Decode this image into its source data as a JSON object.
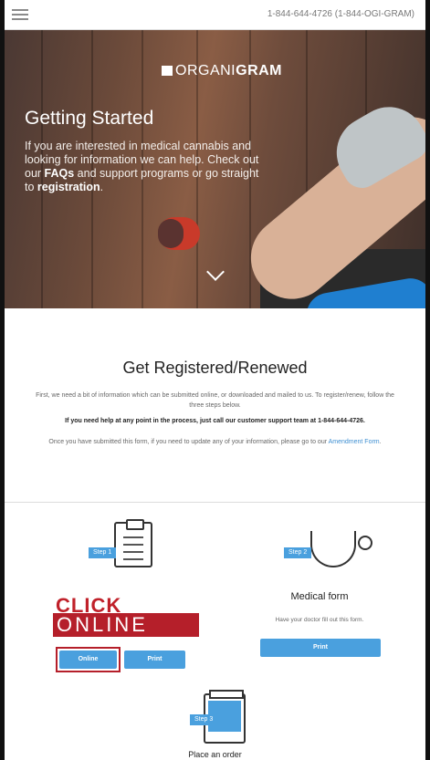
{
  "header": {
    "menu_icon": "hamburger-icon",
    "phone": "1-844-644-4726 (1-844-OGI-GRAM)"
  },
  "hero": {
    "logo_light": "ORGANI",
    "logo_bold": "GRAM",
    "title": "Getting Started",
    "text_1": "If you are interested in medical cannabis and looking for information we can help. Check out our ",
    "faqs_link": "FAQs",
    "text_2": " and support programs or go straight to ",
    "registration_link": "registration",
    "text_3": ".",
    "scroll_icon": "chevron-down-icon"
  },
  "register": {
    "title": "Get Registered/Renewed",
    "para1": "First, we need a bit of information which can be submitted online, or downloaded and mailed to us. To register/renew, follow the three steps below.",
    "para2": "If you need help at any point in the process, just call our customer support team at 1-844-644-4726.",
    "para3": "Once you have submitted this form, if you need to update any of your information, please go to our ",
    "amendment_link": "Amendment Form",
    "para3_end": "."
  },
  "steps": {
    "step1": {
      "tag": "Step 1",
      "icon": "clipboard-icon",
      "click_label": "CLICK",
      "online_banner": "ONLINE",
      "online_button": "Online",
      "print_button": "Print"
    },
    "step2": {
      "tag": "Step 2",
      "icon": "stethoscope-icon",
      "title": "Medical form",
      "subtitle": "Have your doctor fill out this form.",
      "print_button": "Print"
    },
    "step3": {
      "tag": "Step 3",
      "icon": "pill-bottle-icon",
      "title": "Place an order"
    }
  },
  "colors": {
    "accent": "#4aa0de",
    "annotation_red": "#b51f2a"
  }
}
